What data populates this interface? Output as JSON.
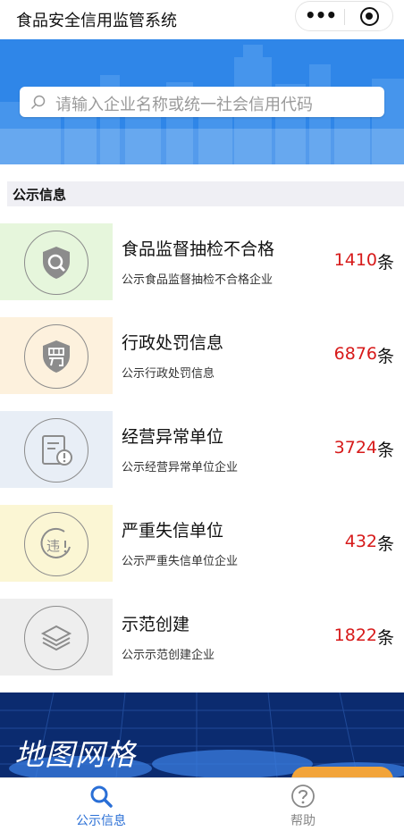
{
  "window": {
    "title": "食品安全信用监管系统"
  },
  "capsule": {
    "more_icon": "ellipsis-icon",
    "close_icon": "target-icon"
  },
  "search": {
    "placeholder": "请输入企业名称或统一社会信用代码"
  },
  "section": {
    "title": "公示信息"
  },
  "items": [
    {
      "name": "食品监督抽检不合格",
      "desc": "公示食品监督抽检不合格企业",
      "count": "1410",
      "unit": "条",
      "icon": "shield-search-icon",
      "tile_color": "#e6f6dc"
    },
    {
      "name": "行政处罚信息",
      "desc": "公示行政处罚信息",
      "count": "6876",
      "unit": "条",
      "icon": "penalty-shield-icon",
      "tile_color": "#fdf1dd"
    },
    {
      "name": "经营异常单位",
      "desc": "公示经营异常单位企业",
      "count": "3724",
      "unit": "条",
      "icon": "abnormal-document-icon",
      "tile_color": "#e8eef6"
    },
    {
      "name": "严重失信单位",
      "desc": "公示严重失信单位企业",
      "count": "432",
      "unit": "条",
      "icon": "violation-icon",
      "tile_color": "#fbf6d4"
    },
    {
      "name": "示范创建",
      "desc": "公示示范创建企业",
      "count": "1822",
      "unit": "条",
      "icon": "layers-icon",
      "tile_color": "#eeeeee"
    }
  ],
  "map_banner": {
    "title": "地图网格"
  },
  "tabbar": {
    "tabs": [
      {
        "label": "公示信息",
        "icon": "search-icon",
        "active": true
      },
      {
        "label": "帮助",
        "icon": "help-icon",
        "active": false
      }
    ]
  },
  "colors": {
    "accent": "#2a6fd6",
    "count_red": "#d71a1a",
    "banner_blue": "#2f86e8"
  }
}
